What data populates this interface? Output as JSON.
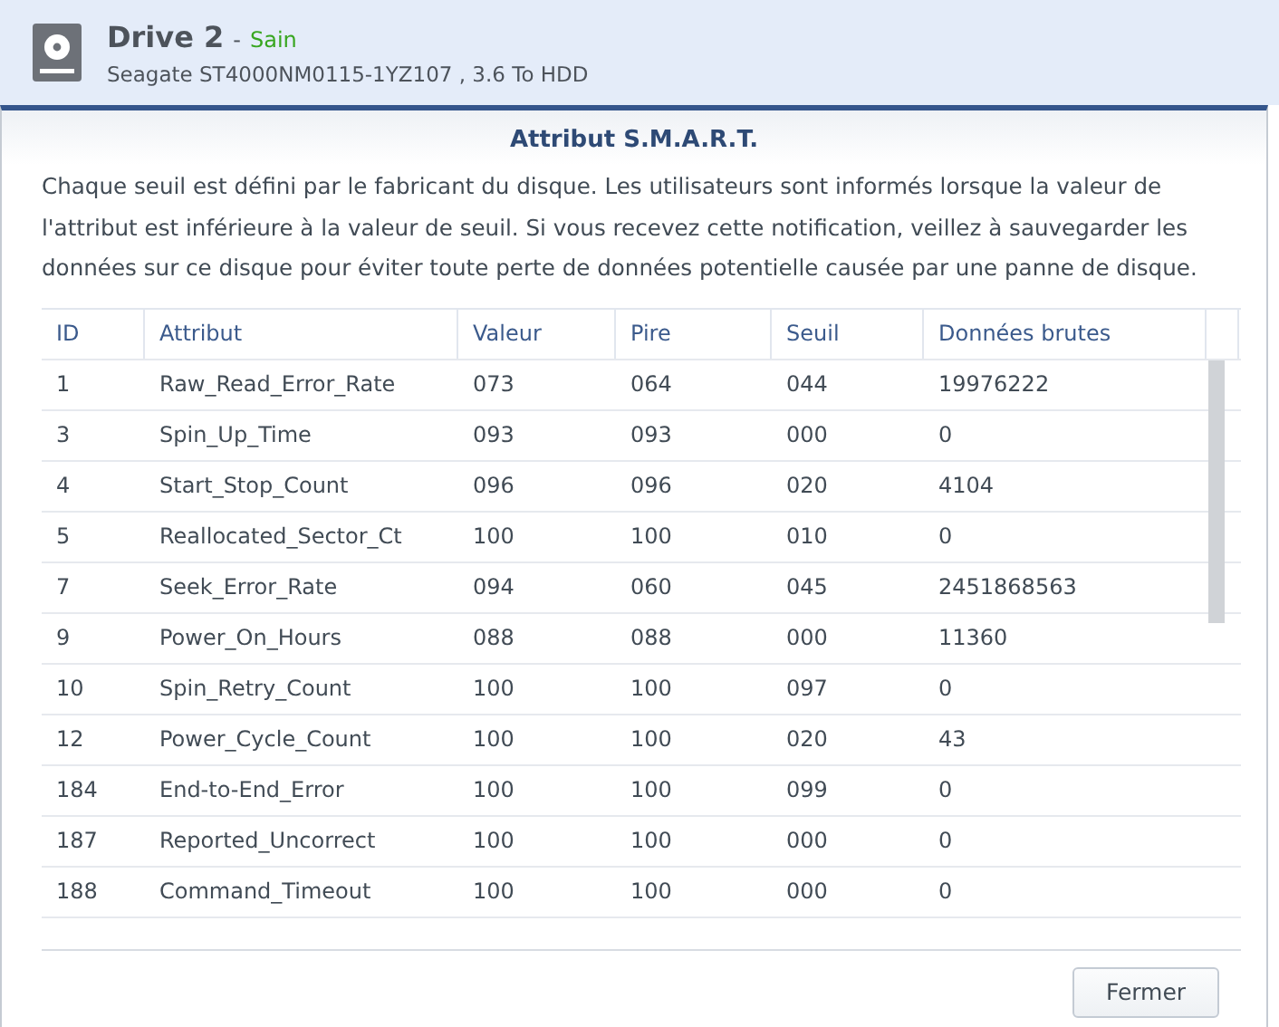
{
  "drive": {
    "name": "Drive 2",
    "separator": "-",
    "status": "Sain",
    "model": "Seagate ST4000NM0115-1YZ107 , 3.6 To HDD"
  },
  "dialog": {
    "title": "Attribut S.M.A.R.T.",
    "description": "Chaque seuil est défini par le fabricant du disque. Les utilisateurs sont informés lorsque la valeur de l'attribut est inférieure à la valeur de seuil. Si vous recevez cette notification, veillez à sauvegarder les données sur ce disque pour éviter toute perte de données potentielle causée par une panne de disque."
  },
  "table": {
    "columns": [
      "ID",
      "Attribut",
      "Valeur",
      "Pire",
      "Seuil",
      "Données brutes"
    ],
    "rows": [
      [
        "1",
        "Raw_Read_Error_Rate",
        "073",
        "064",
        "044",
        "19976222"
      ],
      [
        "3",
        "Spin_Up_Time",
        "093",
        "093",
        "000",
        "0"
      ],
      [
        "4",
        "Start_Stop_Count",
        "096",
        "096",
        "020",
        "4104"
      ],
      [
        "5",
        "Reallocated_Sector_Ct",
        "100",
        "100",
        "010",
        "0"
      ],
      [
        "7",
        "Seek_Error_Rate",
        "094",
        "060",
        "045",
        "2451868563"
      ],
      [
        "9",
        "Power_On_Hours",
        "088",
        "088",
        "000",
        "11360"
      ],
      [
        "10",
        "Spin_Retry_Count",
        "100",
        "100",
        "097",
        "0"
      ],
      [
        "12",
        "Power_Cycle_Count",
        "100",
        "100",
        "020",
        "43"
      ],
      [
        "184",
        "End-to-End_Error",
        "100",
        "100",
        "099",
        "0"
      ],
      [
        "187",
        "Reported_Uncorrect",
        "100",
        "100",
        "000",
        "0"
      ],
      [
        "188",
        "Command_Timeout",
        "100",
        "100",
        "000",
        "0"
      ]
    ]
  },
  "buttons": [
    "Fermer"
  ]
}
